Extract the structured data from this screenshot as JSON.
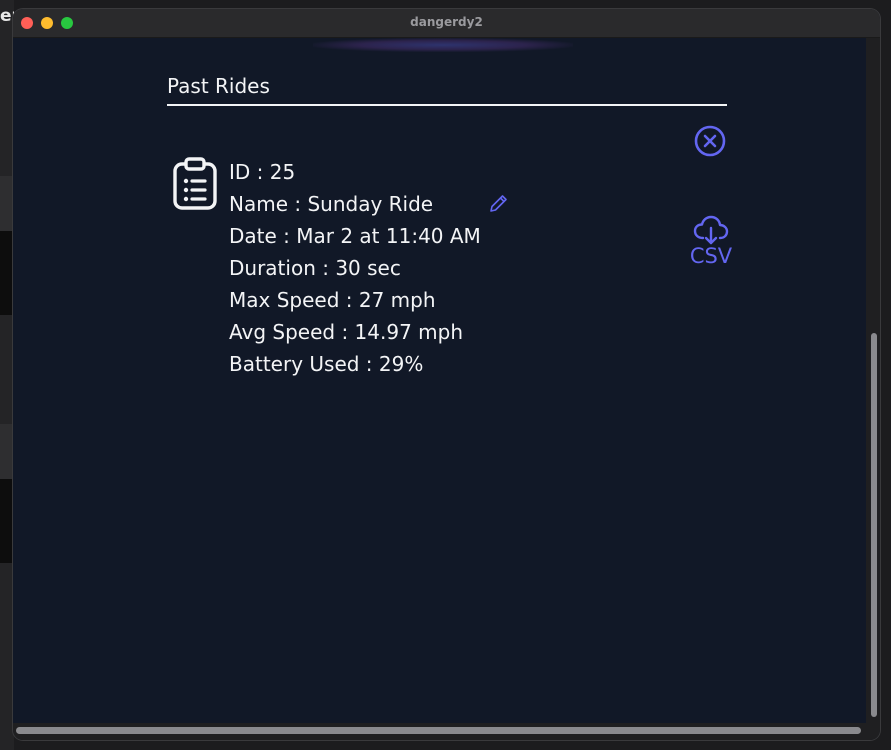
{
  "desktop": {
    "fragment_text": "ep"
  },
  "window": {
    "title": "dangerdy2"
  },
  "panel": {
    "title": "Past Rides"
  },
  "ride": {
    "id_line": "ID : 25",
    "name_line": "Name : Sunday Ride",
    "date_line": "Date : Mar 2 at 11:40 AM",
    "duration_line": "Duration : 30 sec",
    "max_speed_line": "Max Speed : 27 mph",
    "avg_speed_line": "Avg Speed : 14.97 mph",
    "battery_line": "Battery Used : 29%"
  },
  "actions": {
    "csv_label": "CSV"
  },
  "icons": {
    "clipboard": "clipboard-list-icon",
    "edit": "pencil-icon",
    "close": "x-circle-icon",
    "download": "cloud-download-icon"
  },
  "colors": {
    "background": "#111827",
    "text": "#f3f4f6",
    "accent": "#6366f1"
  }
}
